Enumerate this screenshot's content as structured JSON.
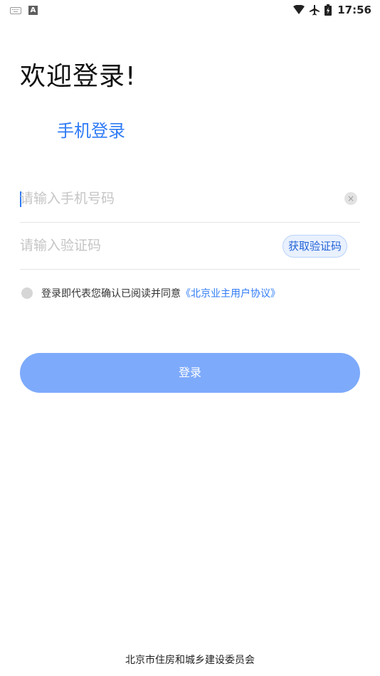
{
  "status_bar": {
    "a_icon_text": "A",
    "time": "17:56",
    "icons": [
      "keyboard-icon",
      "a-notification-icon",
      "wifi-icon",
      "airplane-icon",
      "battery-charging-icon"
    ]
  },
  "page": {
    "welcome_title": "欢迎登录!",
    "tab_label": "手机登录"
  },
  "form": {
    "phone": {
      "value": "",
      "placeholder": "请输入手机号码",
      "clear_icon": "×"
    },
    "code": {
      "value": "",
      "placeholder": "请输入验证码",
      "get_code_label": "获取验证码"
    }
  },
  "agreement": {
    "checked": false,
    "text": "登录即代表您确认已阅读并同意",
    "link_text": "《北京业主用户协议》"
  },
  "login_button": {
    "label": "登录"
  },
  "footer": {
    "text": "北京市住房和城乡建设委员会"
  },
  "colors": {
    "accent": "#2f7bf5",
    "login_button_bg": "#7daafb",
    "get_code_bg": "#e9f1fe",
    "divider": "#e4e4e4",
    "placeholder": "#c5c5c5"
  }
}
